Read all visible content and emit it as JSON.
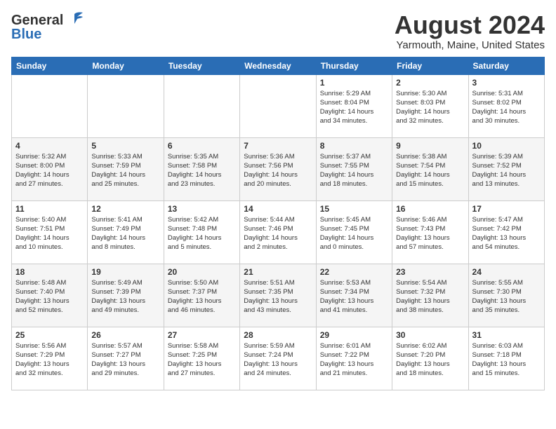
{
  "header": {
    "logo_general": "General",
    "logo_blue": "Blue",
    "month_title": "August 2024",
    "location": "Yarmouth, Maine, United States"
  },
  "days_of_week": [
    "Sunday",
    "Monday",
    "Tuesday",
    "Wednesday",
    "Thursday",
    "Friday",
    "Saturday"
  ],
  "weeks": [
    [
      {
        "day": "",
        "info": ""
      },
      {
        "day": "",
        "info": ""
      },
      {
        "day": "",
        "info": ""
      },
      {
        "day": "",
        "info": ""
      },
      {
        "day": "1",
        "info": "Sunrise: 5:29 AM\nSunset: 8:04 PM\nDaylight: 14 hours\nand 34 minutes."
      },
      {
        "day": "2",
        "info": "Sunrise: 5:30 AM\nSunset: 8:03 PM\nDaylight: 14 hours\nand 32 minutes."
      },
      {
        "day": "3",
        "info": "Sunrise: 5:31 AM\nSunset: 8:02 PM\nDaylight: 14 hours\nand 30 minutes."
      }
    ],
    [
      {
        "day": "4",
        "info": "Sunrise: 5:32 AM\nSunset: 8:00 PM\nDaylight: 14 hours\nand 27 minutes."
      },
      {
        "day": "5",
        "info": "Sunrise: 5:33 AM\nSunset: 7:59 PM\nDaylight: 14 hours\nand 25 minutes."
      },
      {
        "day": "6",
        "info": "Sunrise: 5:35 AM\nSunset: 7:58 PM\nDaylight: 14 hours\nand 23 minutes."
      },
      {
        "day": "7",
        "info": "Sunrise: 5:36 AM\nSunset: 7:56 PM\nDaylight: 14 hours\nand 20 minutes."
      },
      {
        "day": "8",
        "info": "Sunrise: 5:37 AM\nSunset: 7:55 PM\nDaylight: 14 hours\nand 18 minutes."
      },
      {
        "day": "9",
        "info": "Sunrise: 5:38 AM\nSunset: 7:54 PM\nDaylight: 14 hours\nand 15 minutes."
      },
      {
        "day": "10",
        "info": "Sunrise: 5:39 AM\nSunset: 7:52 PM\nDaylight: 14 hours\nand 13 minutes."
      }
    ],
    [
      {
        "day": "11",
        "info": "Sunrise: 5:40 AM\nSunset: 7:51 PM\nDaylight: 14 hours\nand 10 minutes."
      },
      {
        "day": "12",
        "info": "Sunrise: 5:41 AM\nSunset: 7:49 PM\nDaylight: 14 hours\nand 8 minutes."
      },
      {
        "day": "13",
        "info": "Sunrise: 5:42 AM\nSunset: 7:48 PM\nDaylight: 14 hours\nand 5 minutes."
      },
      {
        "day": "14",
        "info": "Sunrise: 5:44 AM\nSunset: 7:46 PM\nDaylight: 14 hours\nand 2 minutes."
      },
      {
        "day": "15",
        "info": "Sunrise: 5:45 AM\nSunset: 7:45 PM\nDaylight: 14 hours\nand 0 minutes."
      },
      {
        "day": "16",
        "info": "Sunrise: 5:46 AM\nSunset: 7:43 PM\nDaylight: 13 hours\nand 57 minutes."
      },
      {
        "day": "17",
        "info": "Sunrise: 5:47 AM\nSunset: 7:42 PM\nDaylight: 13 hours\nand 54 minutes."
      }
    ],
    [
      {
        "day": "18",
        "info": "Sunrise: 5:48 AM\nSunset: 7:40 PM\nDaylight: 13 hours\nand 52 minutes."
      },
      {
        "day": "19",
        "info": "Sunrise: 5:49 AM\nSunset: 7:39 PM\nDaylight: 13 hours\nand 49 minutes."
      },
      {
        "day": "20",
        "info": "Sunrise: 5:50 AM\nSunset: 7:37 PM\nDaylight: 13 hours\nand 46 minutes."
      },
      {
        "day": "21",
        "info": "Sunrise: 5:51 AM\nSunset: 7:35 PM\nDaylight: 13 hours\nand 43 minutes."
      },
      {
        "day": "22",
        "info": "Sunrise: 5:53 AM\nSunset: 7:34 PM\nDaylight: 13 hours\nand 41 minutes."
      },
      {
        "day": "23",
        "info": "Sunrise: 5:54 AM\nSunset: 7:32 PM\nDaylight: 13 hours\nand 38 minutes."
      },
      {
        "day": "24",
        "info": "Sunrise: 5:55 AM\nSunset: 7:30 PM\nDaylight: 13 hours\nand 35 minutes."
      }
    ],
    [
      {
        "day": "25",
        "info": "Sunrise: 5:56 AM\nSunset: 7:29 PM\nDaylight: 13 hours\nand 32 minutes."
      },
      {
        "day": "26",
        "info": "Sunrise: 5:57 AM\nSunset: 7:27 PM\nDaylight: 13 hours\nand 29 minutes."
      },
      {
        "day": "27",
        "info": "Sunrise: 5:58 AM\nSunset: 7:25 PM\nDaylight: 13 hours\nand 27 minutes."
      },
      {
        "day": "28",
        "info": "Sunrise: 5:59 AM\nSunset: 7:24 PM\nDaylight: 13 hours\nand 24 minutes."
      },
      {
        "day": "29",
        "info": "Sunrise: 6:01 AM\nSunset: 7:22 PM\nDaylight: 13 hours\nand 21 minutes."
      },
      {
        "day": "30",
        "info": "Sunrise: 6:02 AM\nSunset: 7:20 PM\nDaylight: 13 hours\nand 18 minutes."
      },
      {
        "day": "31",
        "info": "Sunrise: 6:03 AM\nSunset: 7:18 PM\nDaylight: 13 hours\nand 15 minutes."
      }
    ]
  ]
}
